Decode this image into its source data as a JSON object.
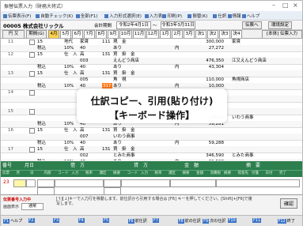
{
  "window": {
    "title": "振替伝票入力（財務大将式）"
  },
  "menu": [
    {
      "icon": "document-icon",
      "label": "伝票表示(F)"
    },
    {
      "icon": "check-icon",
      "label": "自動チェック(K)"
    },
    {
      "icon": "calc-icon",
      "label": "全部(F1)"
    },
    {
      "icon": "input-icon",
      "label": "入力形式選択(E)"
    },
    {
      "icon": "table-icon",
      "label": "入力表"
    },
    {
      "icon": "print-icon",
      "label": "印刷(P)"
    },
    {
      "icon": "transfer-icon",
      "label": "振替(K)"
    },
    {
      "icon": "calendar-icon",
      "label": "仕訳"
    },
    {
      "icon": "info-icon",
      "label": "情報"
    },
    {
      "icon": "help-icon",
      "label": "ヘルプ"
    }
  ],
  "info": {
    "company": "00005 株式会社リックル",
    "period_label": "会計期間",
    "period_from": "令和2年4月1日",
    "period_sep": "～",
    "period_to": "令和3年3月31日",
    "btn_return": "伝票へ",
    "btn_settings": "環境設定"
  },
  "tabs": {
    "type_label": "円 又",
    "kw_label": "期間(G)",
    "months": [
      "4月",
      "5月",
      "6月",
      "7月",
      "8月",
      "9月",
      "10月",
      "11月",
      "12月",
      "1月",
      "2月",
      "3月",
      "決1",
      "決2",
      "決3",
      "決4"
    ],
    "selected_index": 0,
    "mode_label": "[本体] 伝票入力"
  },
  "rows": [
    {
      "n": "11",
      "a": "15",
      "b": "地代",
      "c": "家賃",
      "code": "111",
      "d": "現　金",
      "side": "",
      "amount": "300,000",
      "desc": "家賃"
    },
    {
      "n": "",
      "a": "税込",
      "b": "10%",
      "c": "40",
      "code": "",
      "d": "あり",
      "side": "内",
      "amount": "27,272",
      "desc": ""
    },
    {
      "n": "12",
      "a": "15",
      "b": "仕　入",
      "c": "高",
      "code": "131",
      "d": "買　掛　金",
      "side": "",
      "amount": "",
      "desc": ""
    },
    {
      "n": "",
      "a": "",
      "b": "",
      "c": "003",
      "code": "",
      "d": "えんどう商店",
      "side": "",
      "amount": "476,350",
      "desc": "江又えんどう商店"
    },
    {
      "n": "",
      "a": "税込",
      "b": "10%",
      "c": "40",
      "code": "",
      "d": "あり",
      "side": "内",
      "amount": "43,304",
      "desc": ""
    },
    {
      "n": "13",
      "a": "15",
      "b": "仕　入",
      "c": "高",
      "code": "131",
      "d": "買　掛　金",
      "side": "",
      "amount": "",
      "desc": ""
    },
    {
      "n": "",
      "a": "",
      "b": "",
      "c": "005",
      "code": "",
      "d": "角　視",
      "side": "",
      "amount": "110,000",
      "desc": "角視商店"
    },
    {
      "n": "",
      "a": "税込",
      "b": "10%",
      "c": "40",
      "code": "317",
      "d": "あり",
      "side": "内",
      "amount": "10,000",
      "desc": ""
    },
    {
      "n": "14",
      "a": "",
      "b": "",
      "c": "",
      "code": "",
      "d": "",
      "side": "",
      "amount": "",
      "desc": ""
    },
    {
      "n": "",
      "a": "",
      "b": "",
      "c": "",
      "code": "",
      "d": "",
      "side": "",
      "amount": "",
      "desc": ""
    },
    {
      "n": "",
      "a": "",
      "b": "",
      "c": "",
      "code": "",
      "d": "",
      "side": "",
      "amount": "",
      "desc": ""
    },
    {
      "n": "15",
      "a": "",
      "b": "",
      "c": "",
      "code": "",
      "d": "",
      "side": "",
      "amount": "",
      "desc": ""
    },
    {
      "n": "",
      "a": "",
      "b": "",
      "c": "",
      "code": "",
      "d": "",
      "side": "",
      "amount": "652,1",
      "desc": "いわう商事"
    },
    {
      "n": "",
      "a": "税込",
      "b": "10%",
      "c": "40",
      "code": "",
      "d": "あり",
      "side": "内",
      "amount": "59,281",
      "desc": ""
    },
    {
      "n": "16",
      "a": "15",
      "b": "仕　入",
      "c": "高",
      "code": "131",
      "d": "買　掛　金",
      "side": "",
      "amount": "",
      "desc": ""
    },
    {
      "n": "",
      "a": "",
      "b": "",
      "c": "007",
      "code": "",
      "d": "いわう商事",
      "side": "",
      "amount": "",
      "desc": ""
    },
    {
      "n": "",
      "a": "税込",
      "b": "10%",
      "c": "40",
      "code": "",
      "d": "あり",
      "side": "内",
      "amount": "59,288",
      "desc": ""
    },
    {
      "n": "17",
      "a": "15",
      "b": "仕　入",
      "c": "高",
      "code": "131",
      "d": "買　掛　金",
      "side": "",
      "amount": "",
      "desc": ""
    },
    {
      "n": "",
      "a": "",
      "b": "",
      "c": "002",
      "code": "",
      "d": "とみた商事",
      "side": "",
      "amount": "346,590",
      "desc": "とみた商事"
    },
    {
      "n": "",
      "a": "税込",
      "b": "10%",
      "c": "40",
      "code": "",
      "d": "あり",
      "side": "内",
      "amount": "31,508",
      "desc": ""
    }
  ],
  "overlay": {
    "line1": "仕訳コピー、引用(貼り付け)",
    "line2": "【キーボード操作】"
  },
  "entry_header": {
    "cols": [
      "番号",
      "月日",
      "借　方",
      "貸　方",
      "金　額",
      "摘　要"
    ],
    "subcols": [
      "伝票",
      "月",
      "日",
      "内部",
      "コード",
      "入力",
      "税率",
      "課区",
      "摘要",
      "コード",
      "入力",
      "税率",
      "課区",
      "摘要",
      "金額",
      "消費税",
      "摘要",
      "得意先",
      "付箋",
      "日付",
      "完了"
    ]
  },
  "entry": {
    "num": "23"
  },
  "status": {
    "line1": "伝票番号入力中",
    "line2": "画面表示",
    "tag": "通常",
    "guide": "[↑][↓]キーで入力行を移動します。前仕訳から引用する場合は [F6] キーを押してください。[Shift]+[F6]で複写します。",
    "confirm": "確認"
  },
  "fkeys": [
    {
      "key": "F1",
      "label": "ヘルプ"
    },
    {
      "key": "F2",
      "label": ""
    },
    {
      "key": "F3",
      "label": ""
    },
    {
      "key": "F4",
      "label": ""
    },
    {
      "key": "F5",
      "label": ""
    },
    {
      "key": "F6",
      "label": "前仕訳"
    },
    {
      "key": "F7",
      "label": ""
    },
    {
      "key": "F8",
      "label": "前の仕訳"
    },
    {
      "key": "F9",
      "label": "次の仕訳"
    },
    {
      "key": "F10",
      "label": ""
    },
    {
      "key": "F11",
      "label": ""
    },
    {
      "key": "F12",
      "label": "終了"
    }
  ]
}
